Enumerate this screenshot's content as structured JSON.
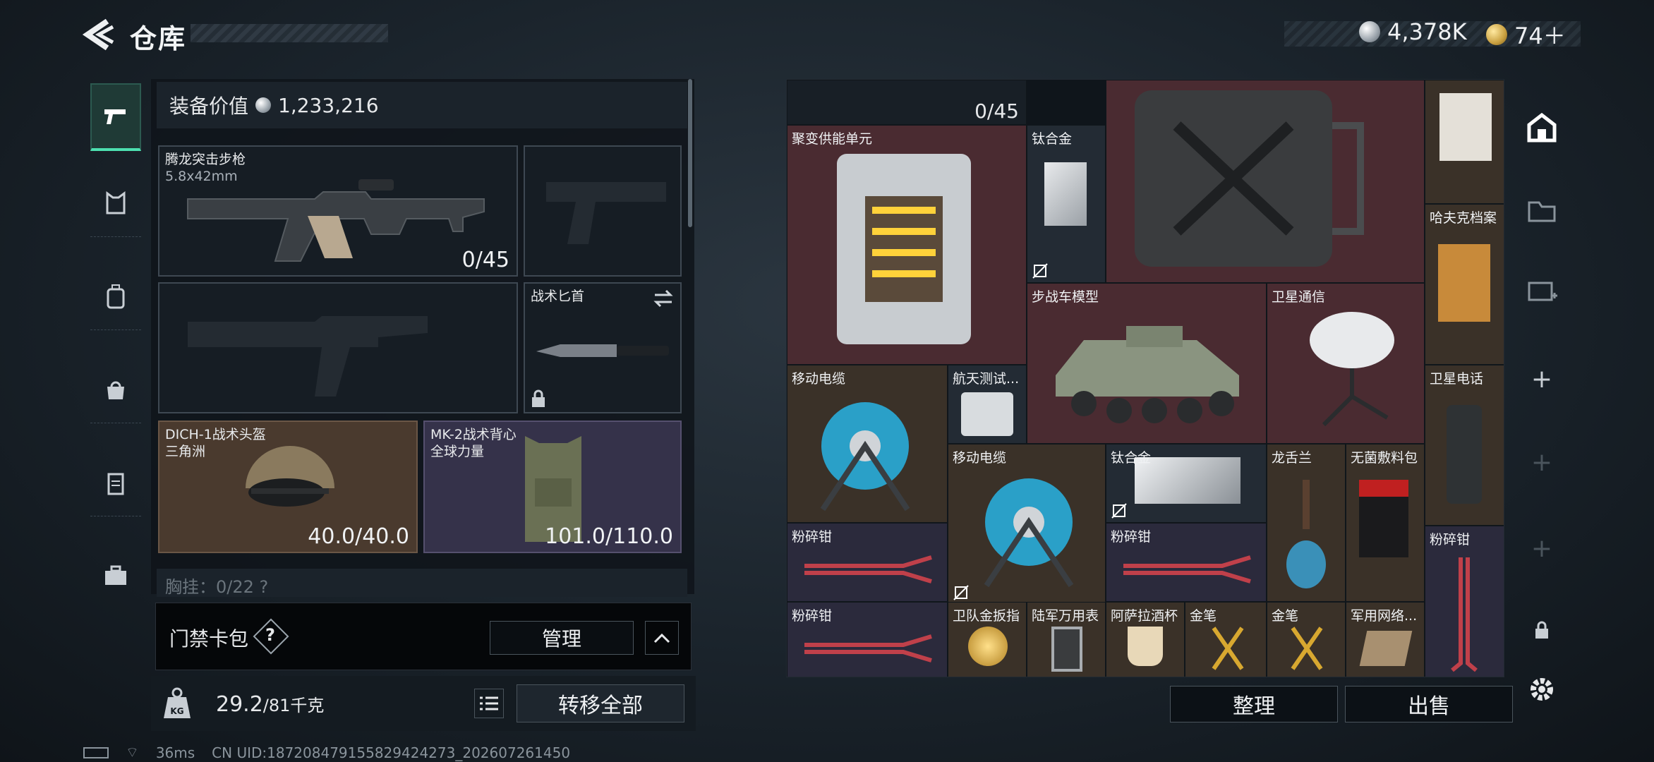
{
  "header": {
    "title": "仓库",
    "currency": [
      {
        "icon": "silver-coin-icon",
        "value": "4,378K"
      },
      {
        "icon": "gold-coin-icon",
        "value": "74＋"
      }
    ]
  },
  "equipment": {
    "value_label": "装备价值",
    "value": "1,233,216",
    "primary": {
      "name": "腾龙突击步枪",
      "ammo": "5.8x42mm",
      "count": "0/45"
    },
    "knife": {
      "name": "战术匕首"
    },
    "helmet": {
      "name": "DICH-1战术头盔",
      "sub": "三角洲",
      "durability": "40.0/40.0"
    },
    "vest": {
      "name": "MK-2战术背心",
      "sub": "全球力量",
      "durability": "101.0/110.0"
    },
    "chest_label": "胸挂：0/22 ?"
  },
  "keycard": {
    "label": "门禁卡包",
    "help": "?",
    "manage": "管理"
  },
  "weight": {
    "current": "29.2",
    "max": "/81千克",
    "kg_icon": "KG",
    "transfer": "转移全部"
  },
  "stash": {
    "top_count": "0/45",
    "items": [
      {
        "id": "fusion",
        "name": "聚变供能单元"
      },
      {
        "id": "ti1",
        "name": "钛合金"
      },
      {
        "id": "ifv",
        "name": "步战车模型"
      },
      {
        "id": "sat",
        "name": "卫星通信"
      },
      {
        "id": "file",
        "name": "哈夫克档案"
      },
      {
        "id": "cable1",
        "name": "移动电缆"
      },
      {
        "id": "disk",
        "name": "航天测试..."
      },
      {
        "id": "satphone",
        "name": "卫星电话"
      },
      {
        "id": "cable2",
        "name": "移动电缆"
      },
      {
        "id": "ti2",
        "name": "钛合金"
      },
      {
        "id": "lily",
        "name": "龙舌兰"
      },
      {
        "id": "dressing",
        "name": "无菌敷料包"
      },
      {
        "id": "p1",
        "name": "粉碎钳"
      },
      {
        "id": "p2",
        "name": "粉碎钳"
      },
      {
        "id": "p3",
        "name": "粉碎钳"
      },
      {
        "id": "p4",
        "name": "粉碎钳"
      },
      {
        "id": "ring",
        "name": "卫队金扳指"
      },
      {
        "id": "meter",
        "name": "陆军万用表"
      },
      {
        "id": "cup",
        "name": "阿萨拉酒杯"
      },
      {
        "id": "pen1",
        "name": "金笔"
      },
      {
        "id": "pen2",
        "name": "金笔"
      },
      {
        "id": "net",
        "name": "军用网络..."
      }
    ]
  },
  "actions": {
    "sort": "整理",
    "sell": "出售"
  },
  "status": {
    "ping": "36ms",
    "uid": "CN UID:18720847915582942427​3_202607261450"
  }
}
